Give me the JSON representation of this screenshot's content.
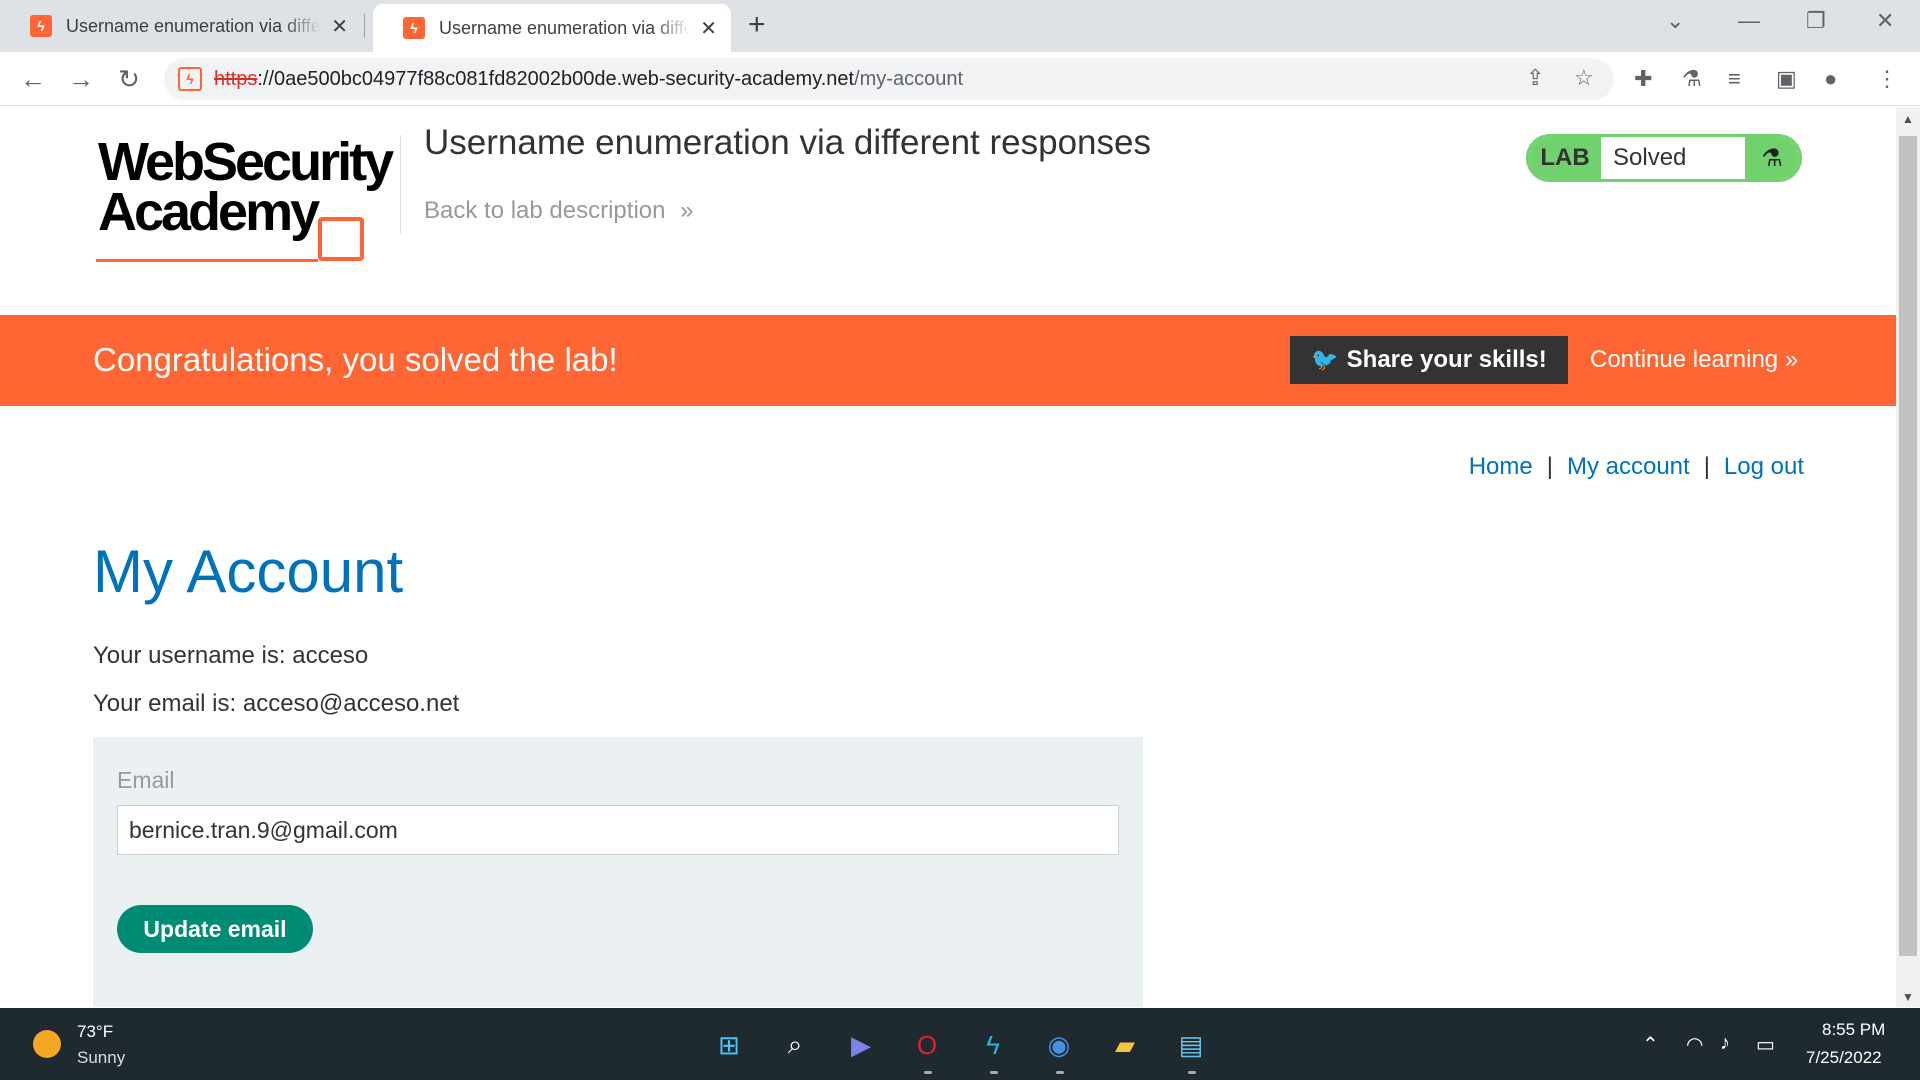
{
  "browser": {
    "tabs": [
      {
        "title": "Username enumeration via differ",
        "active": false
      },
      {
        "title": "Username enumeration via differ",
        "active": true
      }
    ],
    "new_tab": "+",
    "url": {
      "scheme": "https",
      "rest": "://0ae500bc04977f88c081fd82002b00de.web-security-academy.net",
      "path": "/my-account"
    }
  },
  "header": {
    "logo_line1": "WebSecurity",
    "logo_line2": "Academy",
    "lab_title": "Username enumeration via different responses",
    "back_link": "Back to lab description",
    "back_chevron": "»",
    "lab_badge": "LAB",
    "lab_status": "Solved"
  },
  "banner": {
    "message": "Congratulations, you solved the lab!",
    "share_label": "Share your skills!",
    "continue_label": "Continue learning"
  },
  "nav": {
    "home": "Home",
    "my_account": "My account",
    "logout": "Log out",
    "separator": "|"
  },
  "main": {
    "heading": "My Account",
    "username_line": "Your username is: acceso",
    "email_line": "Your email is: acceso@acceso.net",
    "form": {
      "email_label": "Email",
      "email_value": "bernice.tran.9@gmail.com",
      "submit_label": "Update email"
    }
  },
  "taskbar": {
    "weather_temp": "73°F",
    "weather_desc": "Sunny",
    "time": "8:55 PM",
    "date": "7/25/2022"
  },
  "colors": {
    "accent_orange": "#ff6633",
    "link_blue": "#0071bc",
    "solved_green": "#70d16d",
    "button_teal": "#008b74"
  }
}
